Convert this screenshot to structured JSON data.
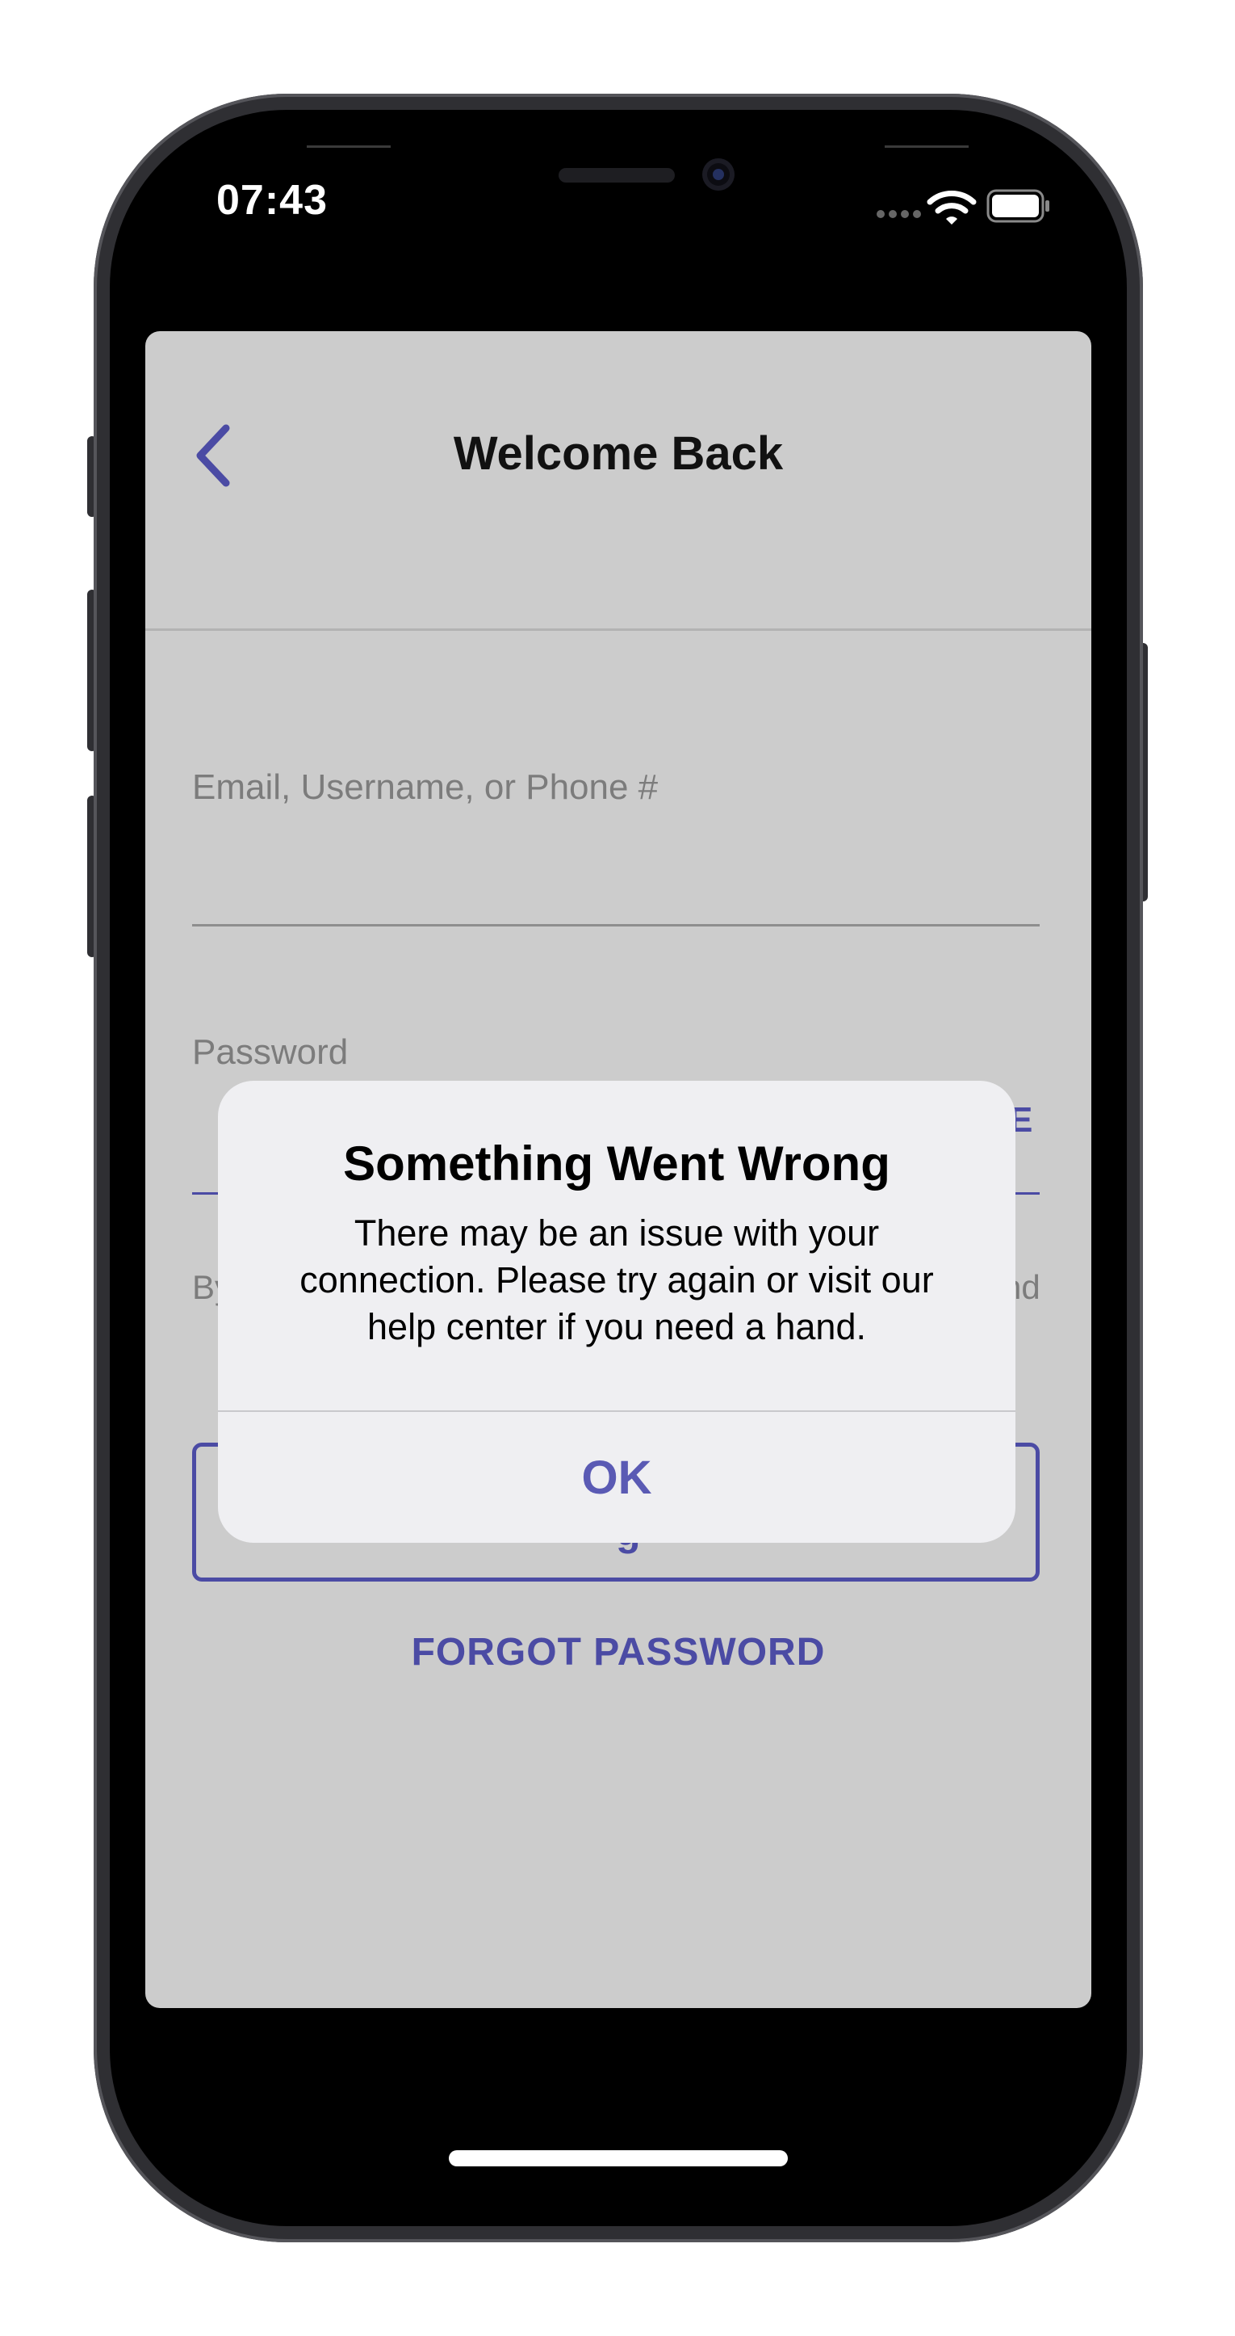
{
  "status_bar": {
    "time": "07:43"
  },
  "header": {
    "title": "Welcome Back"
  },
  "form": {
    "email_label": "Email, Username, or Phone #",
    "password_label": "Password",
    "password_toggle_partial": "E",
    "terms_partial_left": "By",
    "terms_partial_right": "nd",
    "login_button_partial": "g"
  },
  "forgot_password": "FORGOT PASSWORD",
  "alert": {
    "title": "Something Went Wrong",
    "message": "There may be an issue with your connection. Please try again or visit our help center if you need a hand.",
    "ok_label": "OK"
  },
  "colors": {
    "accent": "#4b4ba4",
    "sheet_background": "#cccccc",
    "alert_background": "#efeff2"
  },
  "icons": [
    "back-chevron-icon",
    "wifi-icon",
    "battery-icon",
    "signal-dots-icon"
  ]
}
